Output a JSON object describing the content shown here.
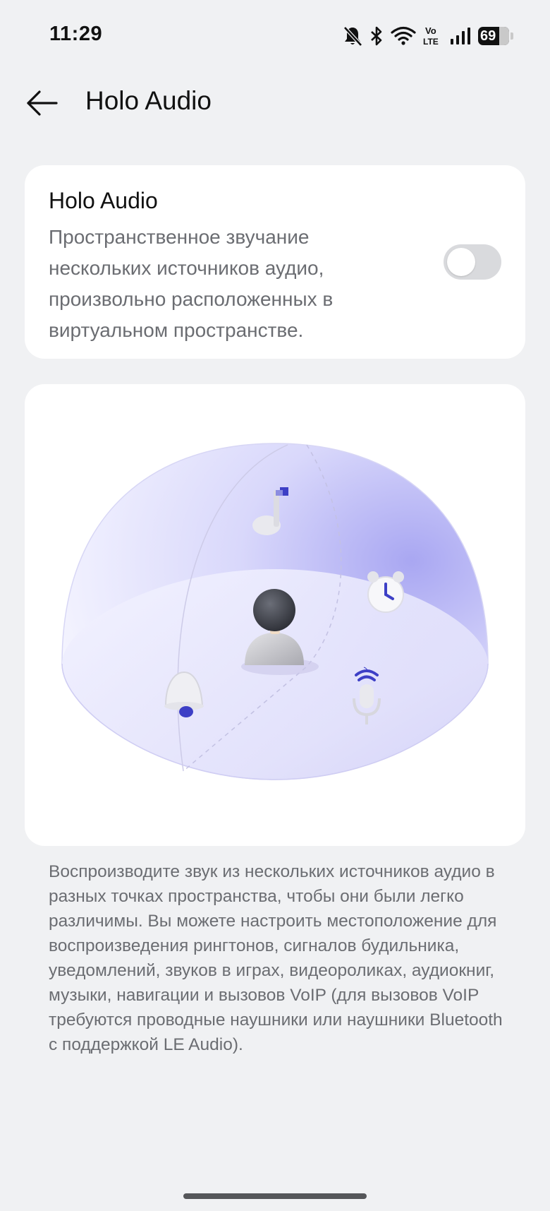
{
  "status_bar": {
    "time": "11:29",
    "battery_level": "69",
    "icons": [
      "bell-off-icon",
      "bluetooth-icon",
      "wifi-icon",
      "volte-icon",
      "signal-icon",
      "battery-icon"
    ],
    "volte_top": "Vo",
    "volte_bottom": "LTE"
  },
  "header": {
    "title": "Holo Audio",
    "back_icon": "arrow-left-icon"
  },
  "toggle_card": {
    "title": "Holo Audio",
    "description": "Пространственное звучание нескольких источников аудио, произвольно расположенных в виртуальном пространстве.",
    "toggle_on": false
  },
  "illustration": {
    "icons": [
      "music-note-icon",
      "alarm-clock-icon",
      "bell-icon",
      "microphone-icon",
      "person-avatar-icon"
    ],
    "accent_color": "#3d3fc6"
  },
  "info_text": "Воспроизводите звук из нескольких источников аудио в разных точках пространства, чтобы они были легко различимы. Вы можете настроить местоположение для воспроизведения рингтонов, сигналов будильника, уведомлений, звуков в играх, видеороликах, аудиокниг, музыки, навигации и вызовов VoIP (для вызовов VoIP требуются проводные наушники или наушники Bluetooth с поддержкой LE Audio)."
}
